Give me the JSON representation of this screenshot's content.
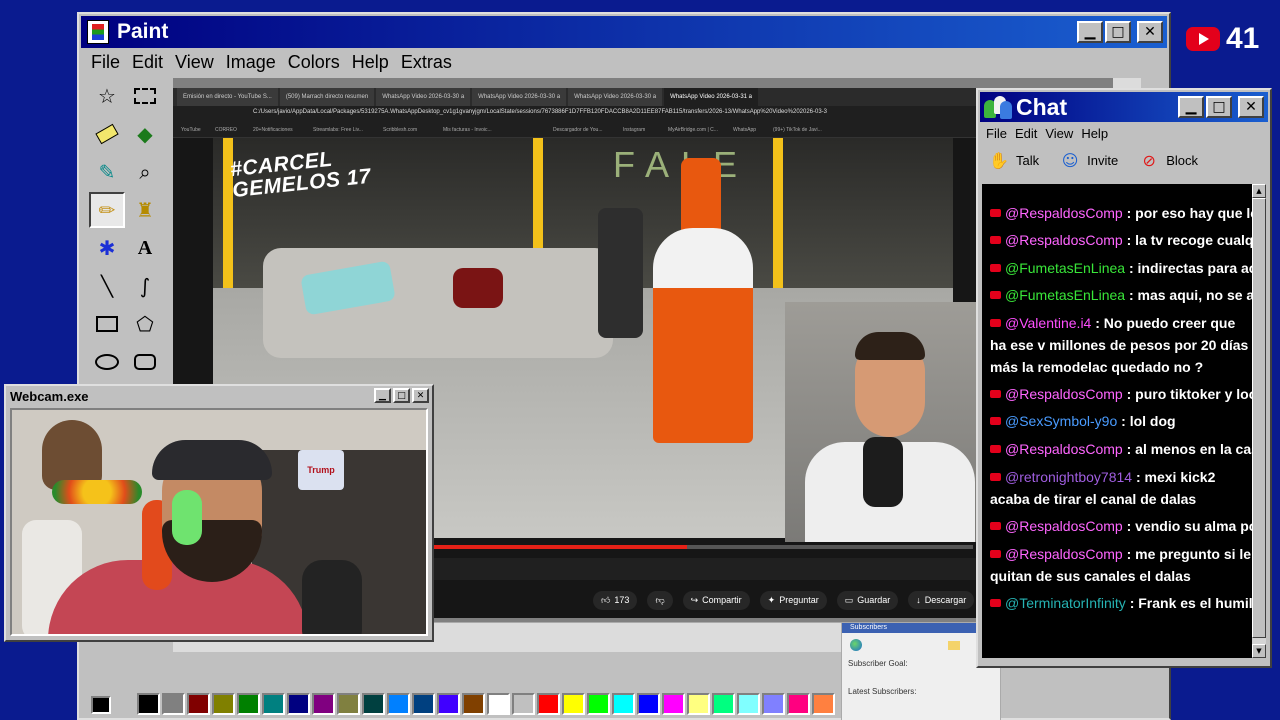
{
  "paint": {
    "title": "Paint",
    "menu": [
      "File",
      "Edit",
      "View",
      "Image",
      "Colors",
      "Help",
      "Extras"
    ],
    "palette": [
      "#000000",
      "#808080",
      "#800000",
      "#808000",
      "#008000",
      "#008080",
      "#000080",
      "#800080",
      "#808040",
      "#004040",
      "#0080ff",
      "#004080",
      "#4000ff",
      "#804000",
      "#ffffff",
      "#c0c0c0",
      "#ff0000",
      "#ffff00",
      "#00ff00",
      "#00ffff",
      "#0000ff",
      "#ff00ff",
      "#ffff80",
      "#00ff80",
      "#80ffff",
      "#8080ff",
      "#ff0080",
      "#ff8040"
    ]
  },
  "browser": {
    "tabs": [
      "Emisión en directo - YouTube S...",
      "(509) Marrach directo resumen",
      "WhatsApp Video 2026-03-30 a",
      "WhatsApp Video 2026-03-30 a",
      "WhatsApp Video 2026-03-30 a",
      "WhatsApp Video 2026-03-31 a"
    ],
    "url": "C:/Users/javio/AppData/Local/Packages/5319275A.WhatsAppDesktop_cv1g1gvanyjgm/LocalState/sessions/7673886F1D7FFB120FDACCB8A2D11EE87FAB115/transfers/2026-13/WhatsApp%20Video%202026-03-3",
    "bookmarks": [
      "YouTube",
      "CORREO",
      "20+Notificaciones",
      "Streamlabs: Free Liv...",
      "Scribblesh.com",
      "Mis facturas - Invoic...",
      "Descargador de You...",
      "Instagram",
      "MyAirBridge.com | C...",
      "WhatsApp",
      "(99+) TikTok de Javi..."
    ],
    "video_overlay": "#CARCEL\nGEMELOS 17",
    "likes": "173",
    "share": "Compartir",
    "ask": "Preguntar",
    "save": "Guardar",
    "download": "Descargar",
    "progress": 0.47
  },
  "subscribers": {
    "header": "Subscribers",
    "goal": "Subscriber Goal:",
    "latest": "Latest Subscribers:"
  },
  "youtube_badge": {
    "count": "41"
  },
  "chat": {
    "title": "Chat",
    "menu": [
      "File",
      "Edit",
      "View",
      "Help"
    ],
    "tools": [
      {
        "label": "Talk",
        "icon": "talk-icon"
      },
      {
        "label": "Invite",
        "icon": "invite-icon"
      },
      {
        "label": "Block",
        "icon": "block-icon"
      }
    ],
    "messages": [
      {
        "user": "@RespaldosComp",
        "color": "#ff66ff",
        "text": " : por eso hay que leer los"
      },
      {
        "user": "@RespaldosComp",
        "color": "#ff66ff",
        "text": " : la tv recoge cualquier m"
      },
      {
        "user": "@FumetasEnLinea",
        "color": "#39e639",
        "text": " : indirectas para acelga ,"
      },
      {
        "user": "@FumetasEnLinea",
        "color": "#39e639",
        "text": " : mas aqui, no se alli pero"
      },
      {
        "user": "@Valentine.i4",
        "color": "#ff4fff",
        "text": " : No puedo creer que ha ese v millones de pesos por 20 días más la remodelac quedado no ?"
      },
      {
        "user": "@RespaldosComp",
        "color": "#ff66ff",
        "text": " : puro tiktoker y loco ahi"
      },
      {
        "user": "@SexSymbol-y9o",
        "color": "#4a9cff",
        "text": " : lol dog"
      },
      {
        "user": "@RespaldosComp",
        "color": "#ff66ff",
        "text": " : al menos en la casa de l"
      },
      {
        "user": "@retronightboy7814",
        "color": "#a05ee0",
        "text": " : mexi kick2 acaba de tirar el canal de dalas"
      },
      {
        "user": "@RespaldosComp",
        "color": "#ff66ff",
        "text": " : vendio su alma por una"
      },
      {
        "user": "@RespaldosComp",
        "color": "#ff66ff",
        "text": " : me pregunto si le quitan de sus canales el dalas"
      },
      {
        "user": "@TerminatorInfinity",
        "color": "#26b3b3",
        "text": " : Frank es el humillado"
      }
    ]
  },
  "webcam": {
    "title": "Webcam.exe",
    "box_label": "Trump"
  }
}
